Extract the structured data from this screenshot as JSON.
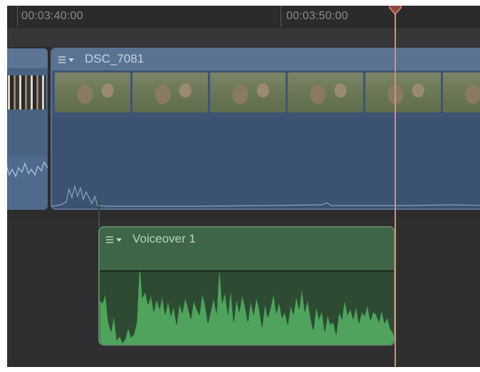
{
  "ruler": {
    "timecodes": [
      "00:03:40:00",
      "00:03:50:00"
    ]
  },
  "clips": {
    "video": {
      "name": "DSC_7081"
    },
    "voiceover": {
      "name": "Voiceover 1"
    }
  },
  "icons": {
    "clip_menu": "clip-options-menu-icon",
    "playhead": "playhead-marker-icon"
  },
  "colors": {
    "video_clip": "#4a6080",
    "audio_clip": "#3f6547",
    "audio_waveform": "#4fa35d",
    "playhead": "#e8867a",
    "background": "#2f2f31"
  }
}
